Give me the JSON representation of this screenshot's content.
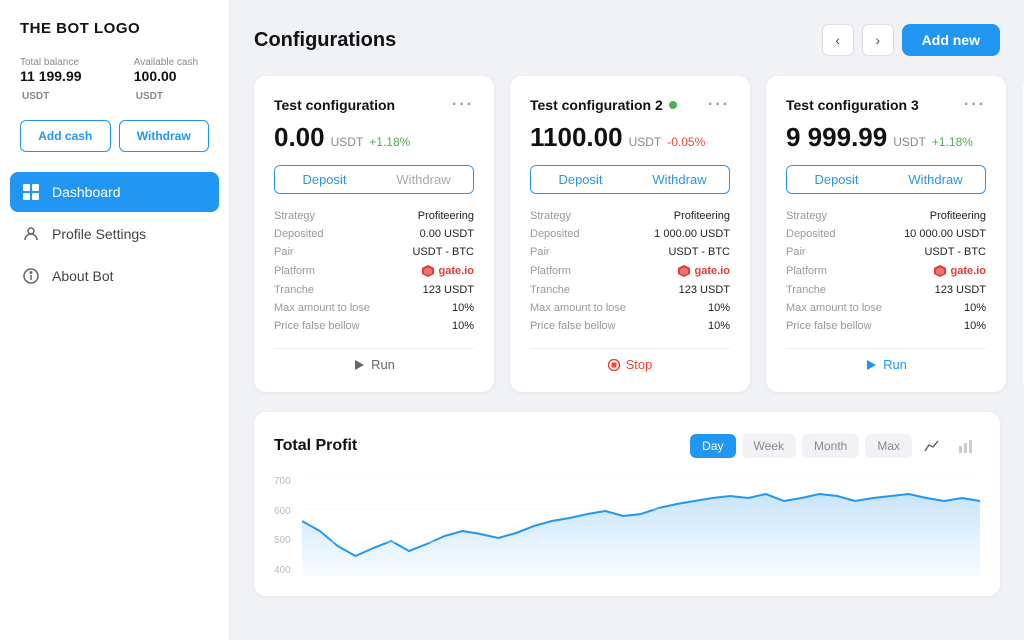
{
  "sidebar": {
    "logo": "THE BOT LOGO",
    "balance": {
      "total_label": "Total balance",
      "total_amount": "11 199.99",
      "total_currency": "USDT",
      "available_label": "Available cash",
      "available_amount": "100.00",
      "available_currency": "USDT"
    },
    "add_cash_label": "Add cash",
    "withdraw_label": "Withdraw",
    "nav_items": [
      {
        "id": "dashboard",
        "label": "Dashboard",
        "active": true,
        "icon": "grid"
      },
      {
        "id": "profile",
        "label": "Profile Settings",
        "active": false,
        "icon": "user"
      },
      {
        "id": "about",
        "label": "About Bot",
        "active": false,
        "icon": "info"
      }
    ]
  },
  "header": {
    "title": "Configurations",
    "add_new_label": "Add new"
  },
  "cards": [
    {
      "id": "card1",
      "title": "Test configuration",
      "active_dot": false,
      "amount": "0.00",
      "currency": "USDT",
      "change": "+1.18%",
      "change_type": "pos",
      "deposit_tab": "Deposit",
      "withdraw_tab": "Withdraw",
      "strategy_label": "Strategy",
      "strategy_value": "Profiteering",
      "deposited_label": "Deposited",
      "deposited_value": "0.00 USDT",
      "pair_label": "Pair",
      "pair_value": "USDT - BTC",
      "platform_label": "Platform",
      "platform_value": "gate.io",
      "tranche_label": "Tranche",
      "tranche_value": "123 USDT",
      "max_lose_label": "Max amount to lose",
      "max_lose_value": "10%",
      "price_false_label": "Price false bellow",
      "price_false_value": "10%",
      "action": "run",
      "action_label": "Run"
    },
    {
      "id": "card2",
      "title": "Test configuration 2",
      "active_dot": true,
      "amount": "1100.00",
      "currency": "USDT",
      "change": "-0.05%",
      "change_type": "neg",
      "deposit_tab": "Deposit",
      "withdraw_tab": "Withdraw",
      "strategy_label": "Strategy",
      "strategy_value": "Profiteering",
      "deposited_label": "Deposited",
      "deposited_value": "1 000.00 USDT",
      "pair_label": "Pair",
      "pair_value": "USDT - BTC",
      "platform_label": "Platform",
      "platform_value": "gate.io",
      "tranche_label": "Tranche",
      "tranche_value": "123 USDT",
      "max_lose_label": "Max amount to lose",
      "max_lose_value": "10%",
      "price_false_label": "Price false bellow",
      "price_false_value": "10%",
      "action": "stop",
      "action_label": "Stop"
    },
    {
      "id": "card3",
      "title": "Test configuration 3",
      "active_dot": false,
      "amount": "9 999.99",
      "currency": "USDT",
      "change": "+1.18%",
      "change_type": "pos",
      "deposit_tab": "Deposit",
      "withdraw_tab": "Withdraw",
      "strategy_label": "Strategy",
      "strategy_value": "Profiteering",
      "deposited_label": "Deposited",
      "deposited_value": "10 000.00 USDT",
      "pair_label": "Pair",
      "pair_value": "USDT - BTC",
      "platform_label": "Platform",
      "platform_value": "gate.io",
      "tranche_label": "Tranche",
      "tranche_value": "123 USDT",
      "max_lose_label": "Max amount to lose",
      "max_lose_value": "10%",
      "price_false_label": "Price false bellow",
      "price_false_value": "10%",
      "action": "run",
      "action_label": "Run"
    }
  ],
  "profit": {
    "title": "Total Profit",
    "time_buttons": [
      {
        "label": "Day",
        "active": true
      },
      {
        "label": "Week",
        "active": false
      },
      {
        "label": "Month",
        "active": false
      },
      {
        "label": "Max",
        "active": false
      }
    ],
    "y_labels": [
      "700",
      "600",
      "500",
      "400"
    ]
  }
}
